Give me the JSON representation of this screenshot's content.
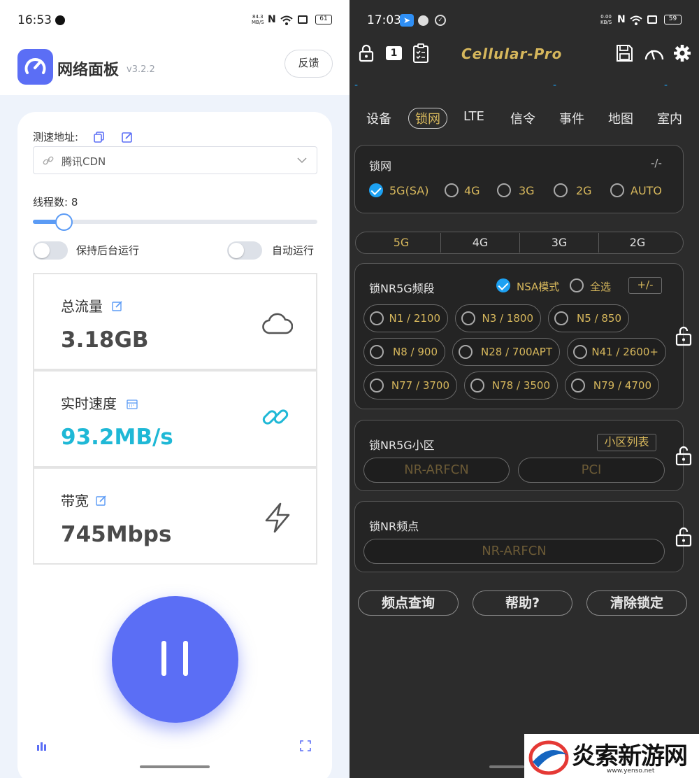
{
  "left": {
    "status_bar": {
      "time": "16:53",
      "net_speed_top": "84.3",
      "net_speed_unit": "MB/S",
      "battery": "61"
    },
    "header": {
      "app_name": "网络面板",
      "version": "v3.2.2",
      "feedback_label": "反馈"
    },
    "speed_url": {
      "label": "测速地址:",
      "selected": "腾讯CDN"
    },
    "threads": {
      "label": "线程数: 8",
      "value": 8
    },
    "toggles": {
      "background_label": "保持后台运行",
      "auto_label": "自动运行"
    },
    "stats": {
      "total_traffic": {
        "title": "总流量",
        "value": "3.18GB"
      },
      "realtime_speed": {
        "title": "实时速度",
        "value": "93.2MB/s"
      },
      "bandwidth": {
        "title": "带宽",
        "value": "745Mbps"
      }
    },
    "colors": {
      "accent": "#5b6ef5",
      "speed_value": "#1fb8d6"
    }
  },
  "right": {
    "status_bar": {
      "time": "17:03",
      "net_speed_top": "0.00",
      "net_speed_unit": "KB/S",
      "battery": "59"
    },
    "toolbar": {
      "sim_badge": "1",
      "brand": "Cellular-Pro"
    },
    "dashes": [
      "-",
      "-",
      "-"
    ],
    "tabs": [
      "设备",
      "锁网",
      "LTE",
      "信令",
      "事件",
      "地图",
      "室内"
    ],
    "active_tab": "锁网",
    "lock_net": {
      "title": "锁网",
      "ratio": "-/-",
      "options": [
        {
          "label": "5G(SA)",
          "checked": true
        },
        {
          "label": "4G",
          "checked": false
        },
        {
          "label": "3G",
          "checked": false
        },
        {
          "label": "2G",
          "checked": false
        },
        {
          "label": "AUTO",
          "checked": false
        }
      ]
    },
    "segments": [
      "5G",
      "4G",
      "3G",
      "2G"
    ],
    "active_segment": "5G",
    "nr_band": {
      "title": "锁NR5G频段",
      "nsa_label": "NSA模式",
      "select_all_label": "全选",
      "plus_minus": "+/-",
      "bands": [
        "N1 / 2100",
        "N3 / 1800",
        "N5 / 850",
        "N8 / 900",
        "N28 / 700APT",
        "N41 / 2600+",
        "N77 / 3700",
        "N78 / 3500",
        "N79 / 4700"
      ]
    },
    "nr_cell": {
      "title": "锁NR5G小区",
      "list_label": "小区列表",
      "arfcn_placeholder": "NR-ARFCN",
      "pci_placeholder": "PCI"
    },
    "nr_freq": {
      "title": "锁NR频点",
      "arfcn_placeholder": "NR-ARFCN"
    },
    "buttons": {
      "freq_query": "频点查询",
      "help": "帮助?",
      "clear_lock": "清除锁定"
    },
    "colors": {
      "gold": "#d6b75c",
      "check_blue": "#1da1f2"
    }
  },
  "watermark": {
    "text": "炎索新游网",
    "url": "www.yenso.net"
  }
}
